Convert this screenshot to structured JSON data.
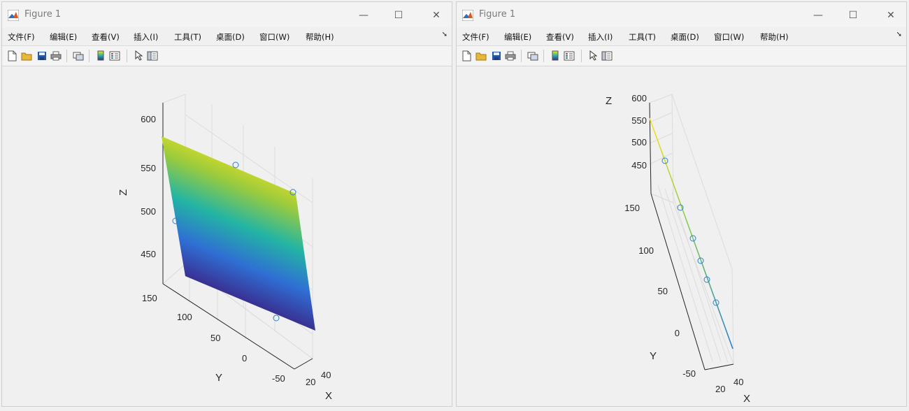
{
  "windows": [
    {
      "title": "Figure 1"
    },
    {
      "title": "Figure 1"
    }
  ],
  "menu": [
    "文件(F)",
    "编辑(E)",
    "查看(V)",
    "插入(I)",
    "工具(T)",
    "桌面(D)",
    "窗口(W)",
    "帮助(H)"
  ],
  "toolbar_icons": [
    "new-figure-icon",
    "open-file-icon",
    "save-icon",
    "print-icon",
    "link-plot-icon",
    "colorbar-icon",
    "legend-icon",
    "pointer-icon",
    "property-editor-icon"
  ],
  "colors": {
    "surface_low": "#3a2a8c",
    "surface_mid": "#23b5a3",
    "surface_high": "#f9e31b",
    "marker": "#2a7fd0"
  },
  "chart_data": [
    {
      "type": "scatter",
      "view": "3d surface with data points",
      "z_ticks": [
        "600",
        "550",
        "500",
        "450"
      ],
      "y_ticks": [
        "150",
        "100",
        "50",
        "0",
        "-50"
      ],
      "x_ticks": [
        "20",
        "40"
      ],
      "xlabel": "X",
      "ylabel": "Y",
      "zlabel": "Z",
      "zlim": [
        410,
        620
      ],
      "ylim": [
        -60,
        160
      ],
      "xlim": [
        10,
        45
      ]
    },
    {
      "type": "scatter",
      "view": "3d surface seen edge-on with data points",
      "z_ticks": [
        "600",
        "550",
        "500",
        "450"
      ],
      "y_ticks": [
        "150",
        "100",
        "50",
        "0",
        "-50"
      ],
      "x_ticks": [
        "20",
        "40"
      ],
      "xlabel": "X",
      "ylabel": "Y",
      "zlabel": "Z"
    }
  ]
}
